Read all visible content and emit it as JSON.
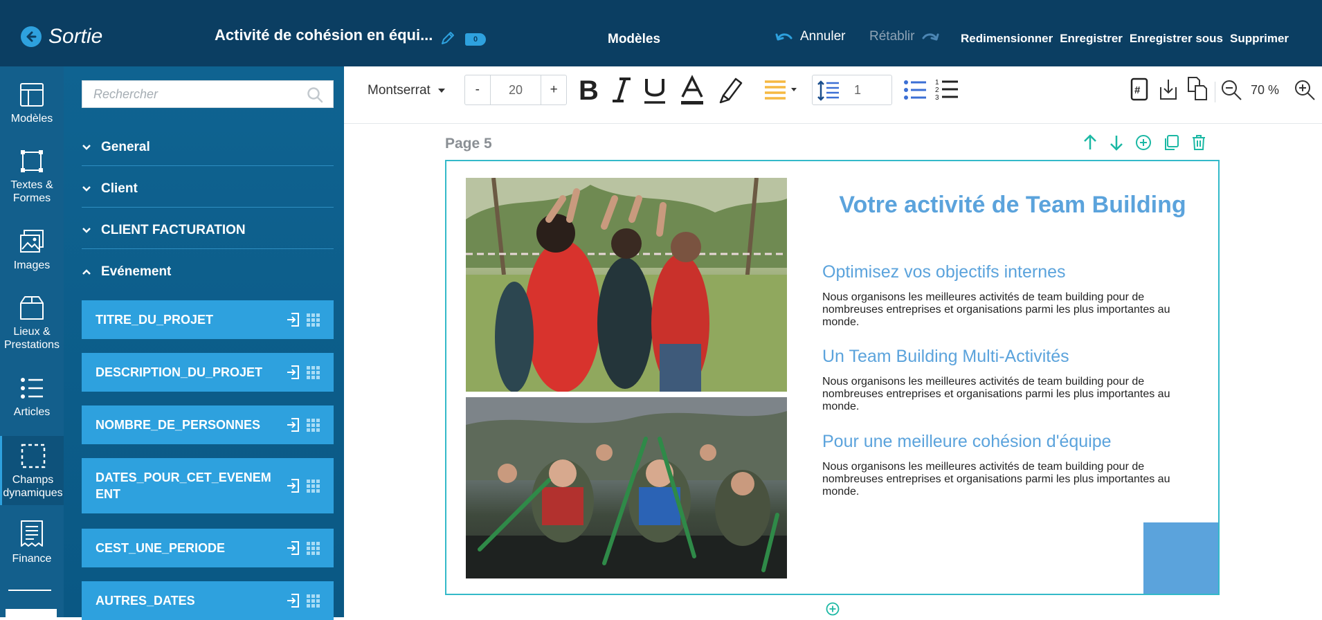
{
  "topbar": {
    "exit_label": "Sortie",
    "doc_title": "Activité de cohésion en équi...",
    "tag_count": "0",
    "templates": "Modèles",
    "undo": "Annuler",
    "redo": "Rétablir",
    "actions": [
      "Redimensionner",
      "Enregistrer",
      "Enregistrer sous",
      "Supprimer"
    ]
  },
  "rail": {
    "items": [
      {
        "label": "Modèles",
        "icon": "layout-icon"
      },
      {
        "label": "Textes & Formes",
        "icon": "shape-icon"
      },
      {
        "label": "Images",
        "icon": "images-icon"
      },
      {
        "label": "Lieux & Prestations",
        "icon": "box-icon"
      },
      {
        "label": "Articles",
        "icon": "list-icon"
      },
      {
        "label": "Champs dynamiques",
        "icon": "dashed-square-icon"
      },
      {
        "label": "Finance",
        "icon": "invoice-icon"
      }
    ],
    "active": "Champs dynamiques"
  },
  "panel": {
    "search_placeholder": "Rechercher",
    "sections": [
      {
        "label": "General",
        "expanded": false
      },
      {
        "label": "Client",
        "expanded": false
      },
      {
        "label": "CLIENT FACTURATION",
        "expanded": false
      },
      {
        "label": "Evénement",
        "expanded": true
      }
    ],
    "fields": [
      "TITRE_DU_PROJET",
      "DESCRIPTION_DU_PROJET",
      "NOMBRE_DE_PERSONNES",
      "DATES_POUR_CET_EVENEMENT",
      "CEST_UNE_PERIODE",
      "AUTRES_DATES"
    ],
    "field_color": "#2ea1de"
  },
  "toolbar": {
    "font": "Montserrat",
    "minus": "-",
    "size": "20",
    "plus": "+",
    "line_spacing": "1",
    "zoom": "70 %"
  },
  "page": {
    "label": "Page 5",
    "title": "Votre activité de Team Building",
    "blocks": [
      {
        "heading": "Optimisez vos objectifs internes",
        "body": "Nous organisons les meilleures activités de team building pour de nombreuses entreprises et organisations parmi les plus importantes au monde."
      },
      {
        "heading": "Un Team Building Multi-Activités",
        "body": "Nous organisons les meilleures activités de team building pour de nombreuses entreprises et organisations parmi les plus importantes au monde."
      },
      {
        "heading": "Pour une meilleure cohésion d'équipe",
        "body": "Nous organisons les meilleures activités de team building pour de nombreuses entreprises et organisations parmi les plus importantes au monde."
      }
    ],
    "accent_color": "#5ba3dc",
    "border_color": "#33b9c9"
  }
}
